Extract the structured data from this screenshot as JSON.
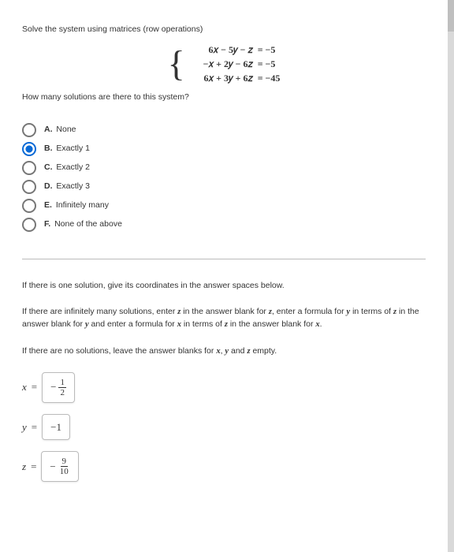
{
  "prompt": "Solve the system using matrices (row operations)",
  "equations": [
    {
      "lhs": "6𝑥 − 5𝑦 − 𝑧",
      "rhs": "= −5"
    },
    {
      "lhs": "−𝑥 + 2𝑦 − 6𝑧",
      "rhs": "= −5"
    },
    {
      "lhs": "6𝑥 + 3𝑦 + 6𝑧",
      "rhs": "= −45"
    }
  ],
  "subquestion": "How many solutions are there to this system?",
  "options": [
    {
      "letter": "A.",
      "text": "None",
      "selected": false
    },
    {
      "letter": "B.",
      "text": "Exactly 1",
      "selected": true
    },
    {
      "letter": "C.",
      "text": "Exactly 2",
      "selected": false
    },
    {
      "letter": "D.",
      "text": "Exactly 3",
      "selected": false
    },
    {
      "letter": "E.",
      "text": "Infinitely many",
      "selected": false
    },
    {
      "letter": "F.",
      "text": "None of the above",
      "selected": false
    }
  ],
  "instructions": {
    "one": "If there is one solution, give its coordinates in the answer spaces below.",
    "inf_a": "If there are infinitely many solutions, enter ",
    "inf_b": " in the answer blank for ",
    "inf_c": ", enter a formula for ",
    "inf_d": " in terms of ",
    "inf_e": " in the answer blank for ",
    "inf_f": " and enter a formula for ",
    "inf_g": " in terms of ",
    "inf_h": " in the answer blank for ",
    "inf_i": ".",
    "none_a": "If there are no solutions, leave the answer blanks for ",
    "none_b": ", ",
    "none_c": " and ",
    "none_d": " empty."
  },
  "vars": {
    "x": "x",
    "y": "y",
    "z": "z"
  },
  "answers": {
    "x": {
      "neg": "−",
      "num": "1",
      "den": "2"
    },
    "y": {
      "plain": "−1"
    },
    "z": {
      "neg": "−",
      "num": "9",
      "den": "10"
    }
  }
}
